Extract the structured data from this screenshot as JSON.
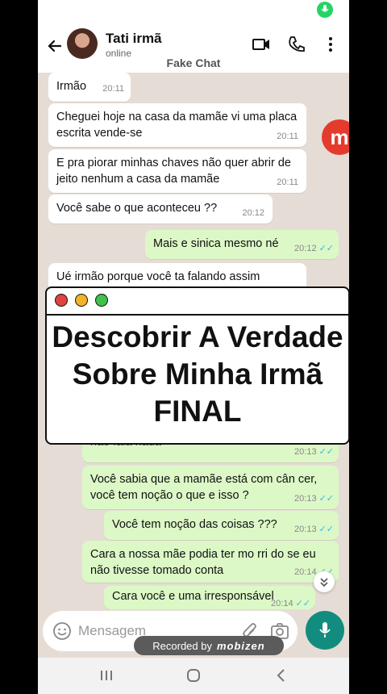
{
  "header": {
    "contact_name": "Tati irmã",
    "contact_status": "online",
    "watermark_title": "Fake Chat"
  },
  "messages": [
    {
      "text": "Irmão",
      "time": "20:11",
      "dir": "in"
    },
    {
      "text": "Cheguei hoje na casa da mamãe vi uma placa escrita vende-se",
      "time": "20:11",
      "dir": "in"
    },
    {
      "text": "E pra piorar minhas chaves não quer abrir de jeito nenhum a casa da mamãe",
      "time": "20:11",
      "dir": "in"
    },
    {
      "text": "Você sabe o que aconteceu ??",
      "time": "20:12",
      "dir": "in"
    },
    {
      "text": "Mais e sinica mesmo né",
      "time": "20:12",
      "dir": "out"
    },
    {
      "text": "Ué irmão porque você ta falando assim",
      "time": "",
      "dir": "in"
    },
    {
      "text": "não fala nada",
      "time": "20:13",
      "dir": "out"
    },
    {
      "text": "Você sabia que a mamãe está com cân cer, você tem noção o que e isso ?",
      "time": "20:13",
      "dir": "out"
    },
    {
      "text": "Você tem noção das coisas ???",
      "time": "20:13",
      "dir": "out"
    },
    {
      "text": "Cara a nossa mãe podia ter mo rri do se eu não tivesse tomado conta",
      "time": "20:14",
      "dir": "out"
    },
    {
      "text": "Cara você e uma irresponsável",
      "time": "20:14",
      "dir": "out"
    }
  ],
  "input": {
    "placeholder": "Mensagem"
  },
  "overlay": {
    "title": "Descobrir A Verdade Sobre Minha Irmã FINAL"
  },
  "recorder": {
    "label": "Recorded by",
    "brand": "mobizen"
  },
  "app_logo": "m",
  "colors": {
    "accent": "#128c7e",
    "outgoing": "#dcf8c6",
    "incoming": "#ffffff",
    "read_ticks": "#34b7f1"
  }
}
